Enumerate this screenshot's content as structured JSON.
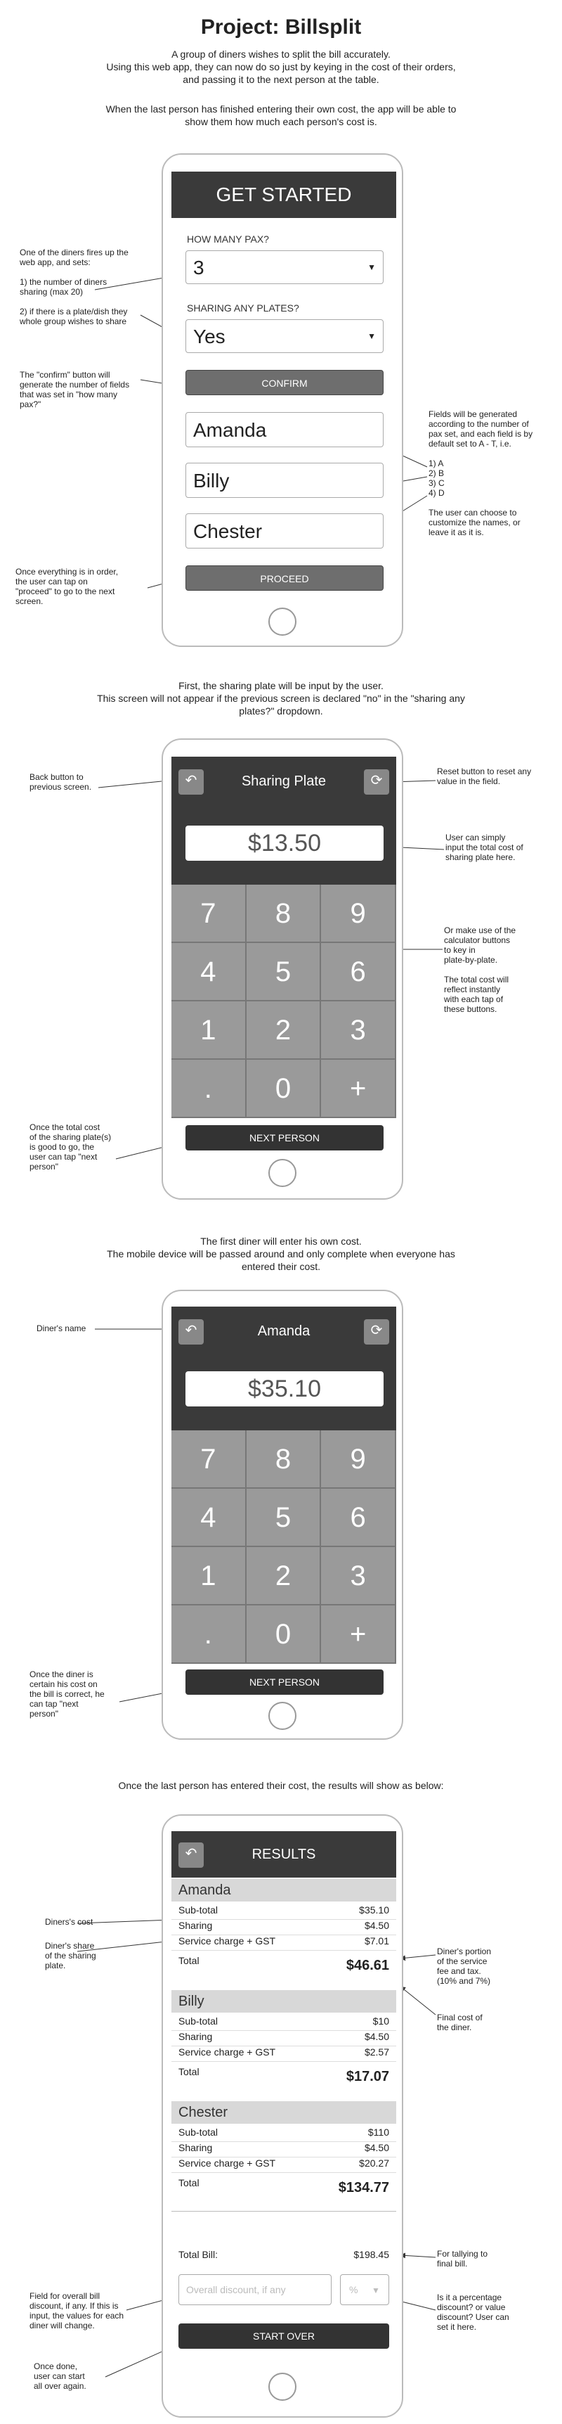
{
  "title": "Project: Billsplit",
  "intro": {
    "lines": [
      "A group of diners wishes to split the bill accurately.",
      "Using this web app, they can now do so just by keying in the cost of their orders,",
      "and passing it to the next person at the table."
    ],
    "lines2": [
      "When the last person has finished entering their own cost, the app will be able to",
      "show them how much each person's cost is."
    ]
  },
  "screen1": {
    "header": "GET STARTED",
    "pax_label": "HOW MANY PAX?",
    "pax_value": "3",
    "sharing_label": "SHARING ANY PLATES?",
    "sharing_value": "Yes",
    "confirm": "CONFIRM",
    "names": [
      "Amanda",
      "Billy",
      "Chester"
    ],
    "proceed": "PROCEED",
    "notes": {
      "left1": [
        "One of the diners fires up the",
        "web app, and sets:",
        "",
        "1) the number of diners",
        "sharing (max 20)",
        "",
        "2) if there is a plate/dish they",
        "whole group wishes to share"
      ],
      "left2": [
        "The \"confirm\" button will",
        "generate the number of fields",
        "that was set in \"how many",
        "pax?\""
      ],
      "left3": [
        "Once everything is in order,",
        "the user can tap on",
        "\"proceed\" to go to the next",
        "screen."
      ],
      "right1": [
        "Fields will be generated",
        "according to the number of",
        "pax set, and each field is by",
        "default set to A - T, i.e.",
        "",
        "1) A",
        "2) B",
        "3) C",
        "4) D",
        "",
        "The user can choose to",
        "customize the names, or",
        "leave it as it is."
      ]
    }
  },
  "section2": {
    "lines": [
      "First, the sharing plate will be input by the user.",
      "This screen will not appear if the previous screen is declared \"no\" in the \"sharing any",
      "plates?\" dropdown."
    ],
    "header": "Sharing Plate",
    "amount": "$13.50",
    "keys": [
      "7",
      "8",
      "9",
      "4",
      "5",
      "6",
      "1",
      "2",
      "3",
      ".",
      "0",
      "+"
    ],
    "next": "NEXT PERSON",
    "notes": {
      "left1": [
        "Back button to",
        "previous screen."
      ],
      "left2": [
        "Once the total cost",
        "of the sharing plate(s)",
        "is good to go, the",
        "user can tap \"next",
        "person\""
      ],
      "right1": [
        "Reset button to reset any",
        "value in the field."
      ],
      "right2": [
        "User can simply",
        "input the total cost of",
        "sharing plate here."
      ],
      "right3": [
        "Or make use of the",
        "calculator buttons",
        "to key in",
        "plate-by-plate.",
        "",
        "The total cost will",
        "reflect instantly",
        "with each tap of",
        "these buttons."
      ]
    }
  },
  "section3": {
    "lines": [
      "The first diner will enter his own cost.",
      "The mobile device will be passed around and only complete when everyone has",
      "entered their cost."
    ],
    "header": "Amanda",
    "amount": "$35.10",
    "keys": [
      "7",
      "8",
      "9",
      "4",
      "5",
      "6",
      "1",
      "2",
      "3",
      ".",
      "0",
      "+"
    ],
    "next": "NEXT PERSON",
    "notes": {
      "left1": [
        "Diner's name"
      ],
      "left2": [
        "Once the diner is",
        "certain his cost on",
        "the bill is correct, he",
        "can tap \"next",
        "person\""
      ]
    }
  },
  "section4": {
    "lines": [
      "Once the last person has entered their cost, the results will show as below:"
    ],
    "header": "RESULTS",
    "diners": [
      {
        "name": "Amanda",
        "subtotal": "$35.10",
        "sharing": "$4.50",
        "service": "$7.01",
        "total": "$46.61"
      },
      {
        "name": "Billy",
        "subtotal": "$10",
        "sharing": "$4.50",
        "service": "$2.57",
        "total": "$17.07"
      },
      {
        "name": "Chester",
        "subtotal": "$110",
        "sharing": "$4.50",
        "service": "$20.27",
        "total": "$134.77"
      }
    ],
    "labels": {
      "subtotal": "Sub-total",
      "sharing": "Sharing",
      "service": "Service charge + GST",
      "total": "Total"
    },
    "total_bill_label": "Total Bill:",
    "total_bill_value": "$198.45",
    "discount_placeholder": "Overall discount, if any",
    "discount_unit": "%",
    "start_over": "START OVER",
    "notes": {
      "left1": [
        "Diners's cost"
      ],
      "left2": [
        "Diner's share",
        "of the sharing",
        "plate."
      ],
      "left3": [
        "Field for overall bill",
        "discount, if any. If this is",
        "input, the values for each",
        "diner will change."
      ],
      "left4": [
        "Once done,",
        "user can start",
        "all over again."
      ],
      "right1": [
        "Diner's portion",
        "of the service",
        "fee and tax.",
        "(10% and 7%)"
      ],
      "right2": [
        "Final cost of",
        "the diner."
      ],
      "right3": [
        "For tallying to",
        "final bill."
      ],
      "right4": [
        "Is it a percentage",
        "discount? or value",
        "discount? User can",
        "set it here."
      ]
    }
  },
  "icons": {
    "back": "back-arrow-icon",
    "reset": "refresh-icon",
    "dropdown": "caret-down-icon",
    "home": "home-button-icon"
  }
}
